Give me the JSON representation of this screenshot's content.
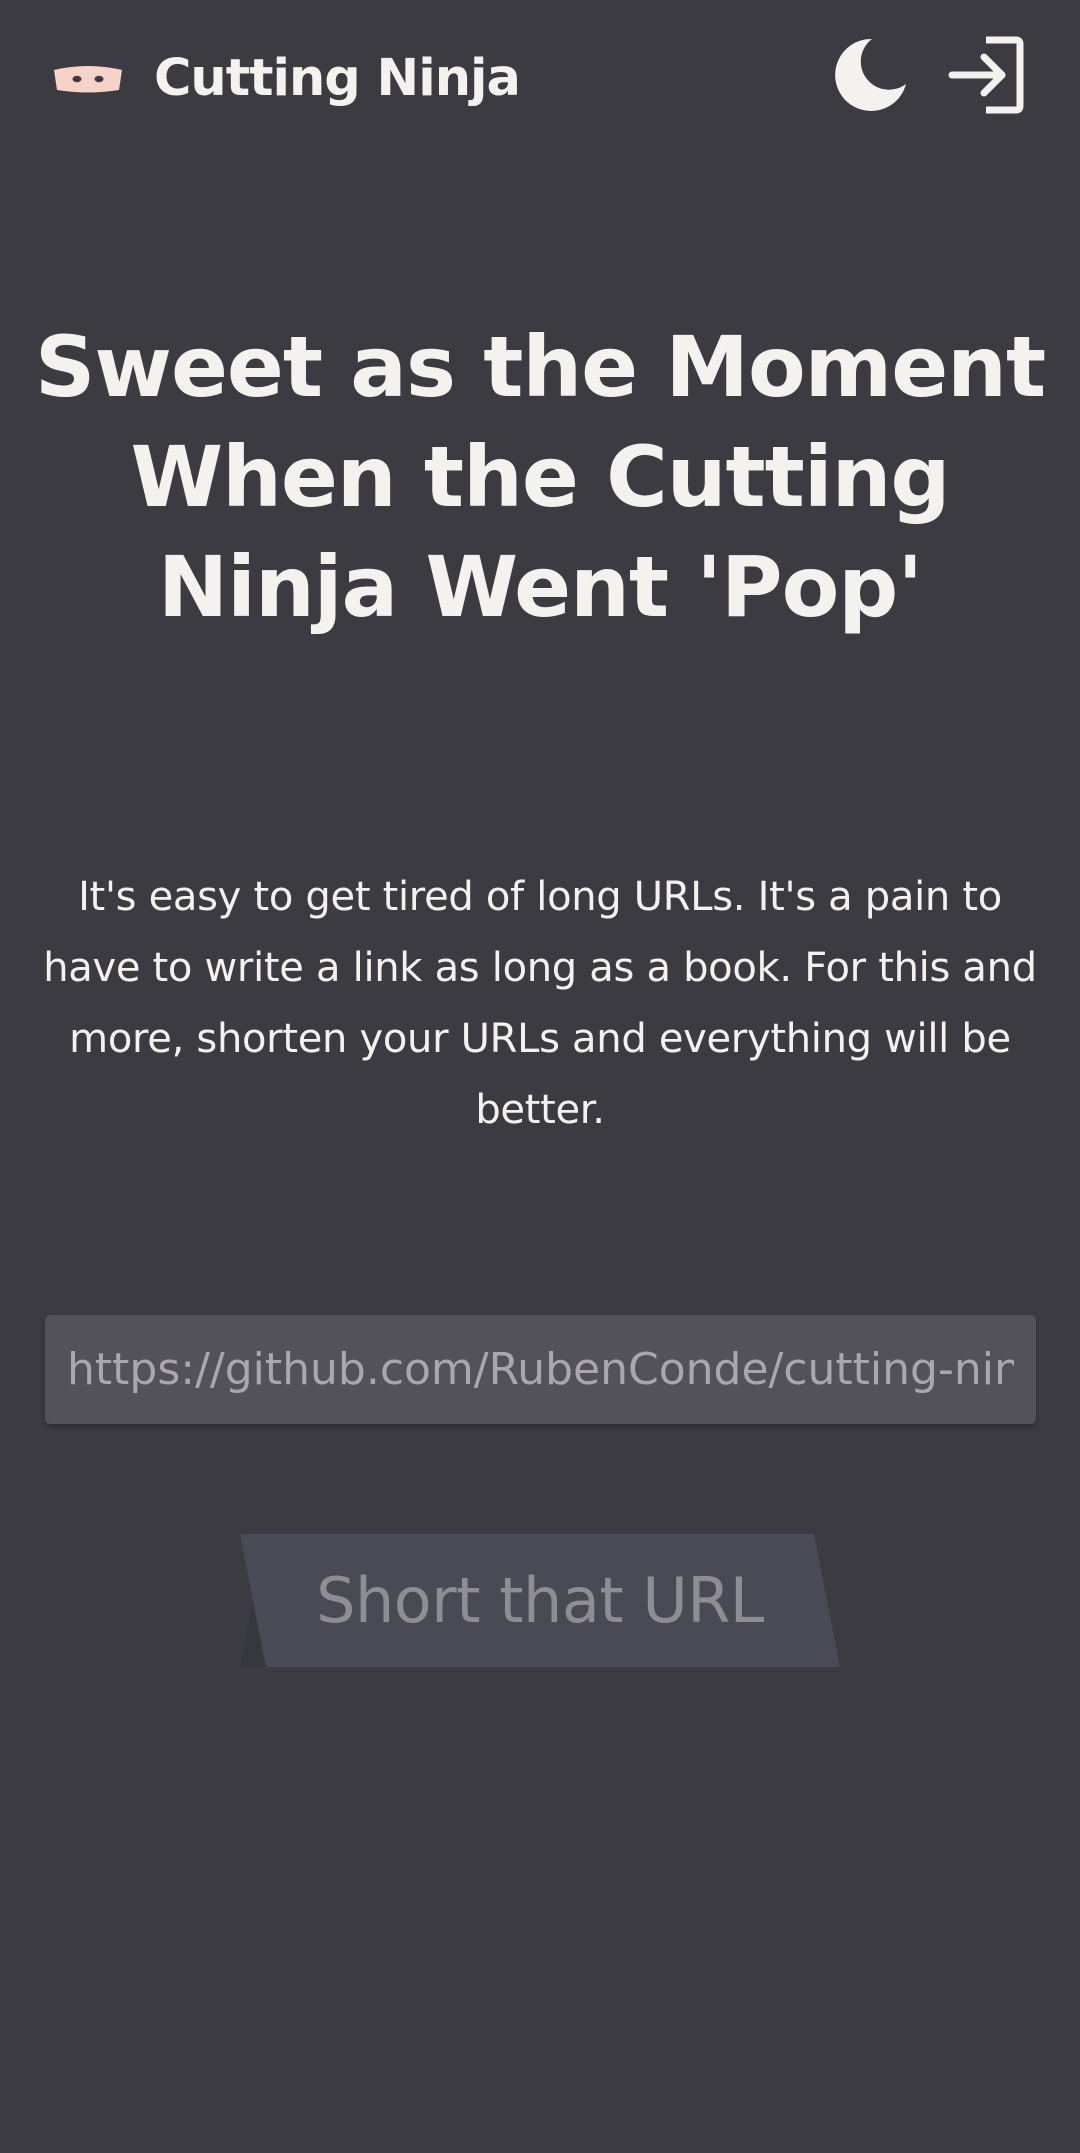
{
  "header": {
    "brand": "Cutting Ninja",
    "logo_icon": "ninja-mask-icon",
    "theme_icon": "moon-icon",
    "login_icon": "sign-in-icon"
  },
  "hero": {
    "title": "Sweet as the Moment When the Cutting Ninja Went 'Pop'",
    "description": "It's easy to get tired of long URLs. It's a pain to have to write a link as long as a book. For this and more, shorten your URLs and everything will be better."
  },
  "form": {
    "url_placeholder": "https://github.com/RubenConde/cutting-ninja",
    "submit_label": "Short that URL"
  },
  "colors": {
    "background": "#3d3b42",
    "text": "#f4f2ef",
    "input_background": "#535159",
    "button_background": "#4a4a54",
    "button_shadow": "#37373e",
    "button_text": "#8e8c94",
    "logo_mask": "#f6d3c6"
  }
}
